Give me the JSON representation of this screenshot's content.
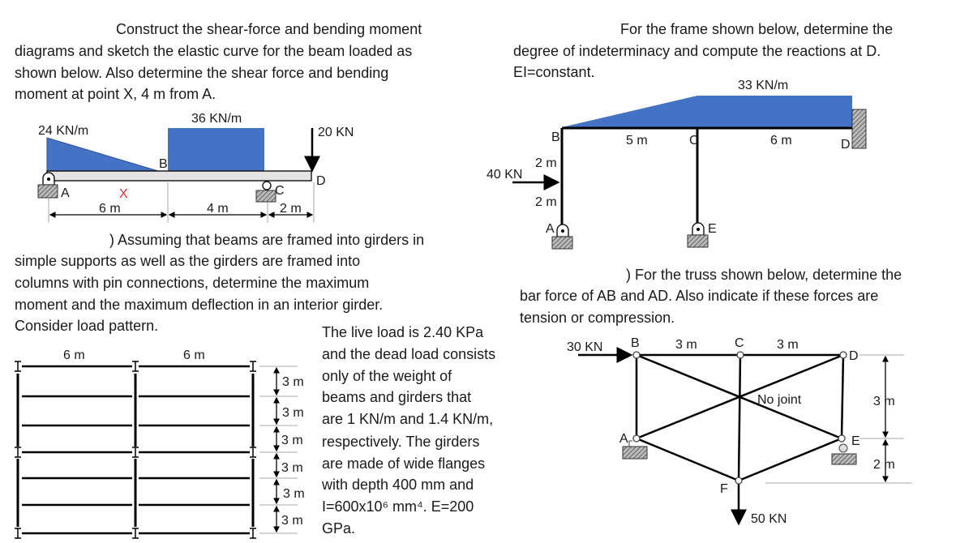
{
  "colors": {
    "load_fill": "#4472c4",
    "marker_x": "#e03030",
    "text": "#1a1a1a"
  },
  "problem1": {
    "lines": [
      "Construct the shear-force and bending moment",
      "diagrams and sketch the elastic curve for the beam loaded as",
      "shown below. Also determine the shear force and bending",
      "moment at point X, 4 m from A."
    ],
    "labels": {
      "w1": "24 KN/m",
      "w2": "36 KN/m",
      "p": "20 KN",
      "a": "A",
      "b": "B",
      "c": "C",
      "d": "D",
      "x": "X",
      "dim1": "6 m",
      "dim2": "4 m",
      "dim3": "2 m"
    }
  },
  "problem2": {
    "lines": [
      "For the frame shown below, determine the",
      "degree of indeterminacy and compute the reactions at D.",
      "EI=constant."
    ],
    "labels": {
      "w": "33 KN/m",
      "p": "40 KN",
      "a": "A",
      "b": "B",
      "c": "C",
      "d": "D",
      "e": "E",
      "bc": "5 m",
      "cd": "6 m",
      "h1": "2 m",
      "h2": "2 m"
    }
  },
  "problem3": {
    "lines": [
      ") Assuming that beams are framed into girders in",
      "simple supports as well as the girders are framed into",
      "columns with pin connections, determine the maximum",
      "moment and the maximum deflection in an interior girder.",
      "Consider load pattern."
    ],
    "side_lines": [
      "The live load is 2.40 KPa",
      "and the dead load consists",
      "only of the weight of",
      "beams and girders that",
      "are 1 KN/m and 1.4 KN/m,",
      "respectively. The girders",
      "are made of wide flanges",
      "with depth 400 mm and",
      "I=600x10⁶ mm⁴. E=200",
      "GPa."
    ],
    "labels": {
      "span1": "6 m",
      "span2": "6 m",
      "spacing": [
        "3 m",
        "3 m",
        "3 m",
        "3 m",
        "3 m",
        "3 m"
      ]
    }
  },
  "problem4": {
    "lines": [
      ") For the truss shown below, determine the",
      "bar force of AB and AD. Also indicate if these forces are",
      "tension or compression."
    ],
    "labels": {
      "p1": "30 KN",
      "p2": "50 KN",
      "a": "A",
      "b": "B",
      "c": "C",
      "d": "D",
      "e": "E",
      "f": "F",
      "bc": "3 m",
      "cd": "3 m",
      "h1": "3 m",
      "h2": "2 m",
      "note": "No joint"
    }
  }
}
